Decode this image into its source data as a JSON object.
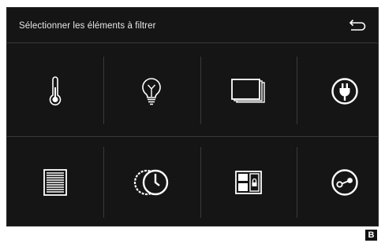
{
  "header": {
    "title": "Sélectionner les éléments à filtrer"
  },
  "back_icon": "back-arrow-icon",
  "tiles": [
    {
      "icon": "thermometer-icon"
    },
    {
      "icon": "lightbulb-icon"
    },
    {
      "icon": "rolling-shutter-icon"
    },
    {
      "icon": "power-plug-icon"
    },
    {
      "icon": "blinds-icon"
    },
    {
      "icon": "timer-icon"
    },
    {
      "icon": "access-control-icon"
    },
    {
      "icon": "switch-on-off-icon"
    }
  ],
  "corner_label": "B",
  "colors": {
    "background": "#151515",
    "icon": "#ffffff",
    "separator": "#3a3a3a"
  }
}
